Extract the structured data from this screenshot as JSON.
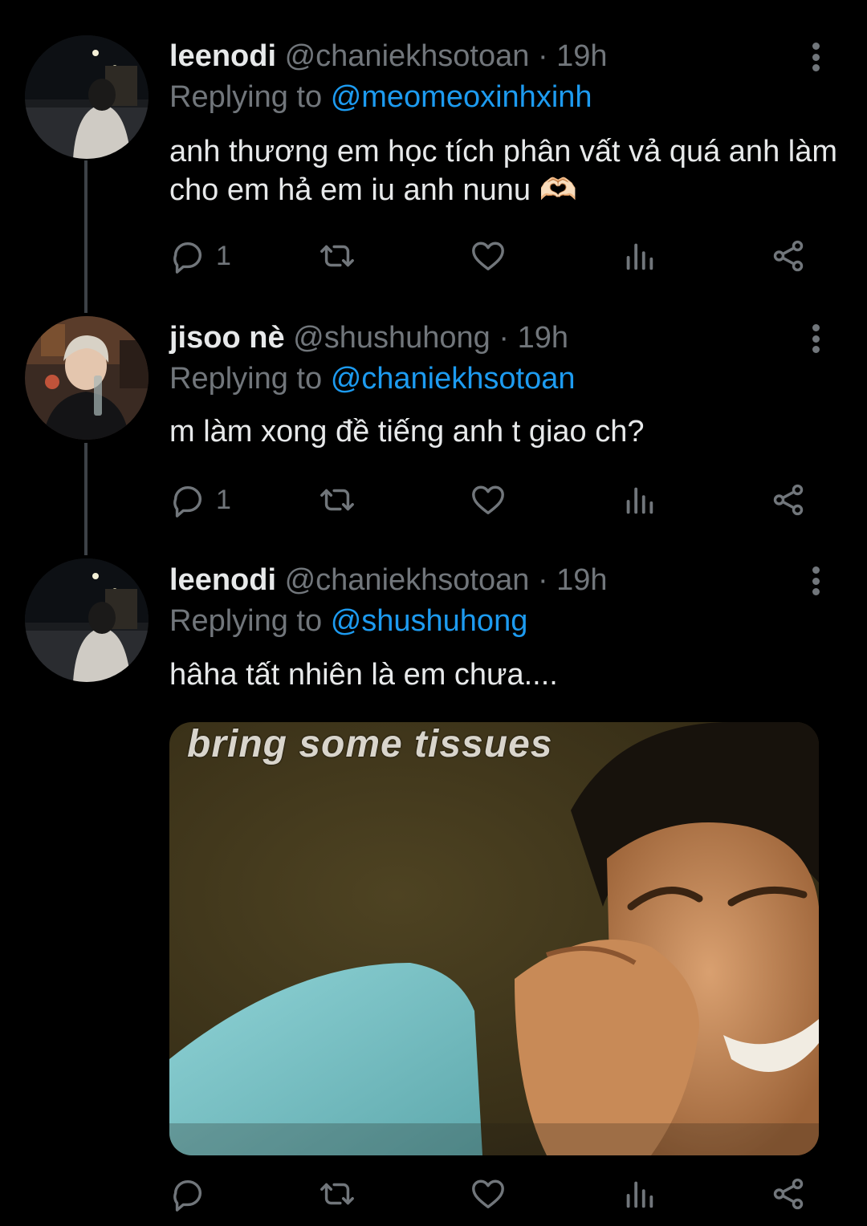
{
  "tweets": [
    {
      "name": "leenodi",
      "handle": "@chaniekhsotoan",
      "sep": "·",
      "time": "19h",
      "reply_prefix": "Replying to",
      "reply_mention": "@meomeoxinhxinh",
      "text": "anh thương em học tích phân vất vả quá anh làm cho em hả em iu anh nunu 🫶🏻",
      "reply_count": "1"
    },
    {
      "name": "jisoo nè",
      "handle": "@shushuhong",
      "sep": "·",
      "time": "19h",
      "reply_prefix": "Replying to",
      "reply_mention": "@chaniekhsotoan",
      "text": "m làm xong đề tiếng anh t giao ch?",
      "reply_count": "1"
    },
    {
      "name": "leenodi",
      "handle": "@chaniekhsotoan",
      "sep": "·",
      "time": "19h",
      "reply_prefix": "Replying to",
      "reply_mention": "@shushuhong",
      "text": "hâha tất nhiên là em chưa....",
      "reply_count": "",
      "media_caption": "bring some tissues"
    }
  ],
  "icons": {
    "reply": "reply-bubble-icon",
    "retweet": "retweet-icon",
    "like": "heart-icon",
    "views": "analytics-icon",
    "share": "share-icon",
    "more": "more-vertical-icon"
  },
  "colors": {
    "background": "#000000",
    "text": "#e7e9ea",
    "muted": "#71767b",
    "mention": "#1d9bf0",
    "connector": "#3d4247"
  }
}
